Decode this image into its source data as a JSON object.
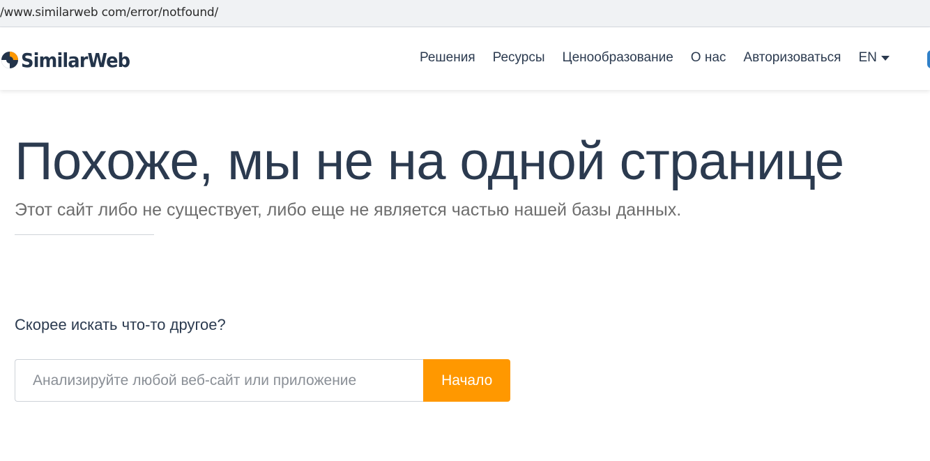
{
  "browser": {
    "url": "/www.similarweb com/error/notfound/"
  },
  "header": {
    "logo_text": "SimilarWeb",
    "nav": [
      {
        "label": "Решения"
      },
      {
        "label": "Ресурсы"
      },
      {
        "label": "Ценообразование"
      },
      {
        "label": "О нас"
      },
      {
        "label": "Авторизоваться"
      }
    ],
    "language": "EN"
  },
  "main": {
    "title": "Похоже, мы не на одной странице",
    "subtitle": "Этот сайт либо не существует, либо еще не является частью нашей базы данных.",
    "search": {
      "label": "Скорее искать что-то другое?",
      "placeholder": "Анализируйте любой веб-сайт или приложение",
      "value": "",
      "button_label": "Начало"
    }
  },
  "colors": {
    "brand_dark": "#23344a",
    "accent_orange": "#ff9800",
    "text_primary": "#2b3a4f",
    "text_muted": "#6d6d6d"
  },
  "icons": {
    "logo": "similarweb-logo-icon",
    "language_caret": "chevron-down-icon"
  }
}
